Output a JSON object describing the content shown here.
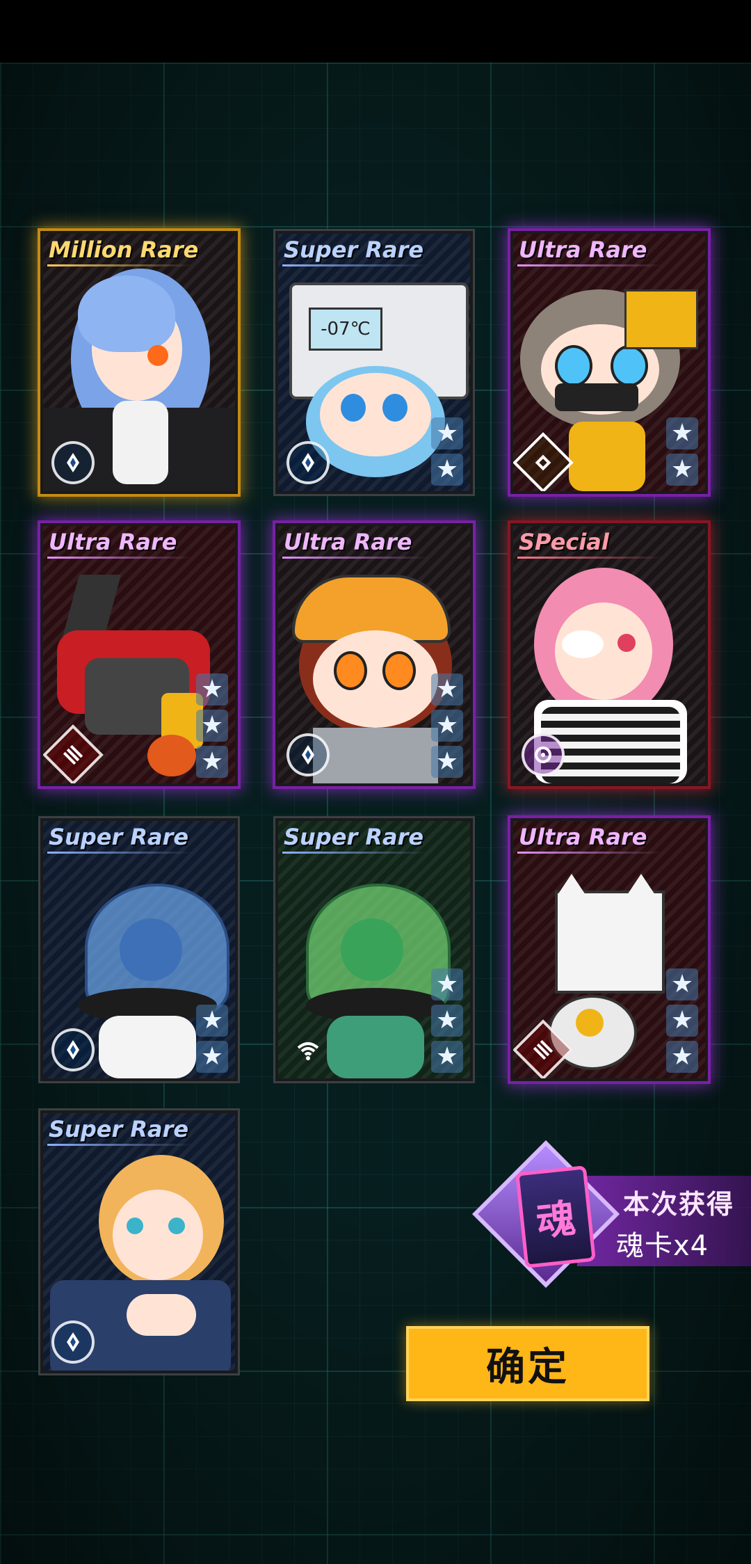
{
  "cards": [
    {
      "rarity": "Million Rare",
      "stars": 0
    },
    {
      "rarity": "Super Rare",
      "stars": 2,
      "screen_text": "-07℃"
    },
    {
      "rarity": "Ultra Rare",
      "stars": 2
    },
    {
      "rarity": "Ultra Rare",
      "stars": 3
    },
    {
      "rarity": "Ultra Rare",
      "stars": 3
    },
    {
      "rarity": "SPecial",
      "stars": 0
    },
    {
      "rarity": "Super Rare",
      "stars": 2
    },
    {
      "rarity": "Super Rare",
      "stars": 3
    },
    {
      "rarity": "Ultra Rare",
      "stars": 3
    },
    {
      "rarity": "Super Rare",
      "stars": 0
    }
  ],
  "reward": {
    "glyph": "魂",
    "line1": "本次获得",
    "line2": "魂卡x4"
  },
  "confirm_label": "确定",
  "star_glyph": "★",
  "colors": {
    "confirm_bg": "#ffb617",
    "glow_million": "#c48b12",
    "glow_ultra": "#7a1fa6",
    "glow_special": "#8a1521"
  }
}
